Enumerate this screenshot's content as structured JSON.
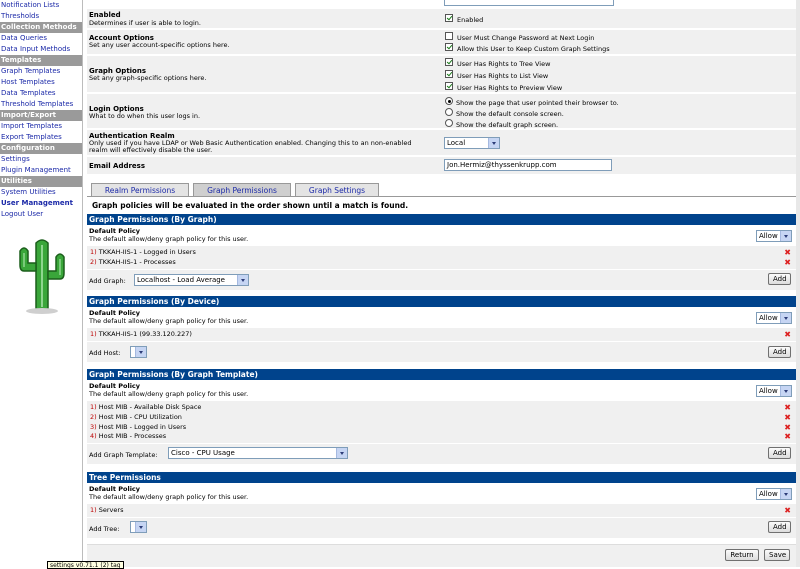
{
  "sidebar": {
    "items": [
      {
        "type": "link",
        "label": "Notification Lists"
      },
      {
        "type": "link",
        "label": "Thresholds"
      },
      {
        "type": "header",
        "label": "Collection Methods"
      },
      {
        "type": "link",
        "label": "Data Queries"
      },
      {
        "type": "link",
        "label": "Data Input Methods"
      },
      {
        "type": "header",
        "label": "Templates"
      },
      {
        "type": "link",
        "label": "Graph Templates"
      },
      {
        "type": "link",
        "label": "Host Templates"
      },
      {
        "type": "link",
        "label": "Data Templates"
      },
      {
        "type": "link",
        "label": "Threshold Templates"
      },
      {
        "type": "header",
        "label": "Import/Export"
      },
      {
        "type": "link",
        "label": "Import Templates"
      },
      {
        "type": "link",
        "label": "Export Templates"
      },
      {
        "type": "header",
        "label": "Configuration"
      },
      {
        "type": "link",
        "label": "Settings"
      },
      {
        "type": "link",
        "label": "Plugin Management"
      },
      {
        "type": "header",
        "label": "Utilities"
      },
      {
        "type": "link",
        "label": "System Utilities"
      },
      {
        "type": "selected",
        "label": "User Management"
      },
      {
        "type": "link",
        "label": "Logout User"
      }
    ]
  },
  "options": {
    "enabled": {
      "title": "Enabled",
      "desc": "Determines if user is able to login.",
      "checkbox_label": "Enabled",
      "checked": true
    },
    "account": {
      "title": "Account Options",
      "desc": "Set any user account-specific options here.",
      "checks": [
        {
          "label": "User Must Change Password at Next Login",
          "checked": false
        },
        {
          "label": "Allow this User to Keep Custom Graph Settings",
          "checked": true
        }
      ]
    },
    "graph": {
      "title": "Graph Options",
      "desc": "Set any graph-specific options here.",
      "checks": [
        {
          "label": "User Has Rights to Tree View",
          "checked": true
        },
        {
          "label": "User Has Rights to List View",
          "checked": true
        },
        {
          "label": "User Has Rights to Preview View",
          "checked": true
        }
      ]
    },
    "login": {
      "title": "Login Options",
      "desc": "What to do when this user logs in.",
      "radios": [
        {
          "label": "Show the page that user pointed their browser to.",
          "selected": true
        },
        {
          "label": "Show the default console screen.",
          "selected": false
        },
        {
          "label": "Show the default graph screen.",
          "selected": false
        }
      ]
    },
    "realm": {
      "title": "Authentication Realm",
      "desc1": "Only used if you have LDAP or Web Basic Authentication enabled. Changing this to an non-enabled",
      "desc2": "realm will effectively disable the user.",
      "value": "Local"
    },
    "email": {
      "title": "Email Address",
      "value": "Jon.Hermiz@thyssenkrupp.com"
    }
  },
  "tabs": [
    "Realm Permissions",
    "Graph Permissions",
    "Graph Settings"
  ],
  "policy_note": "Graph policies will be evaluated in the order shown until a match is found.",
  "policy": {
    "title": "Default Policy",
    "desc": "The default allow/deny graph policy for this user.",
    "value": "Allow"
  },
  "sections": {
    "by_graph": {
      "header": "Graph Permissions (By Graph)",
      "items": [
        {
          "num": "1)",
          "label": "TKKAH-IIS-1 - Logged in Users"
        },
        {
          "num": "2)",
          "label": "TKKAH-IIS-1 - Processes"
        }
      ],
      "add_label": "Add Graph:",
      "add_value": "Localhost - Load Average"
    },
    "by_device": {
      "header": "Graph Permissions (By Device)",
      "items": [
        {
          "num": "1)",
          "label": "TKKAH-IIS-1 (99.33.120.227)"
        }
      ],
      "add_label": "Add Host:",
      "add_value": ""
    },
    "by_template": {
      "header": "Graph Permissions (By Graph Template)",
      "items": [
        {
          "num": "1)",
          "label": "Host MIB - Available Disk Space"
        },
        {
          "num": "2)",
          "label": "Host MIB - CPU Utilization"
        },
        {
          "num": "3)",
          "label": "Host MIB - Logged in Users"
        },
        {
          "num": "4)",
          "label": "Host MIB - Processes"
        }
      ],
      "add_label": "Add Graph Template:",
      "add_value": "Cisco - CPU Usage"
    },
    "tree": {
      "header": "Tree Permissions",
      "items": [
        {
          "num": "1)",
          "label": "Servers"
        }
      ],
      "add_label": "Add Tree:",
      "add_value": ""
    }
  },
  "buttons": {
    "add": "Add",
    "return": "Return",
    "save": "Save"
  },
  "status_tip": "settings v0.71.1 (2) tag",
  "colors": {
    "section_header": "#00438c",
    "link": "#1c2aa8",
    "nav_header": "#9a9a9a",
    "delete": "#dd2222"
  }
}
